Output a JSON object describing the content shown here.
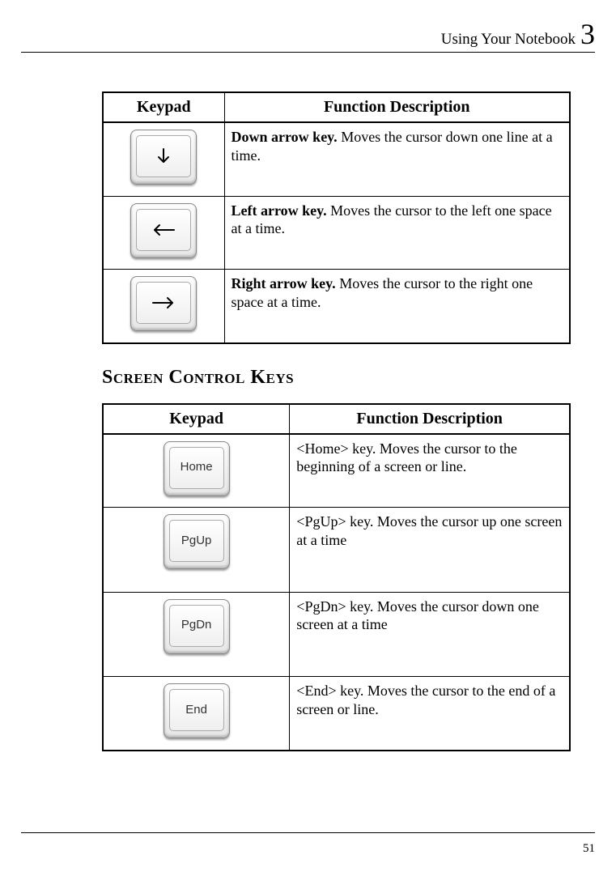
{
  "header": {
    "title": "Using Your Notebook",
    "chapter_number": "3"
  },
  "table1": {
    "col_keypad": "Keypad",
    "col_desc": "Function Description",
    "rows": [
      {
        "icon": "arrow-down",
        "bold": "Down arrow key.",
        "rest": " Moves the cursor down one line at a time."
      },
      {
        "icon": "arrow-left",
        "bold": "Left arrow key.",
        "rest": " Moves the cursor to the left one space at a time."
      },
      {
        "icon": "arrow-right",
        "bold": "Right arrow key.",
        "rest": " Moves the cursor to the right one space at a time."
      }
    ]
  },
  "section_heading": "Screen Control Keys",
  "table2": {
    "col_keypad": "Keypad",
    "col_desc": "Function Description",
    "rows": [
      {
        "label": "Home",
        "text": "<Home> key. Moves the cursor to the beginning of a screen or line."
      },
      {
        "label": "PgUp",
        "text": "<PgUp> key. Moves the cursor up one screen at a time"
      },
      {
        "label": "PgDn",
        "text": "<PgDn> key. Moves the cursor down one screen at a time"
      },
      {
        "label": "End",
        "text": "<End> key. Moves the cursor to the end of a screen or line."
      }
    ]
  },
  "page_number": "51"
}
